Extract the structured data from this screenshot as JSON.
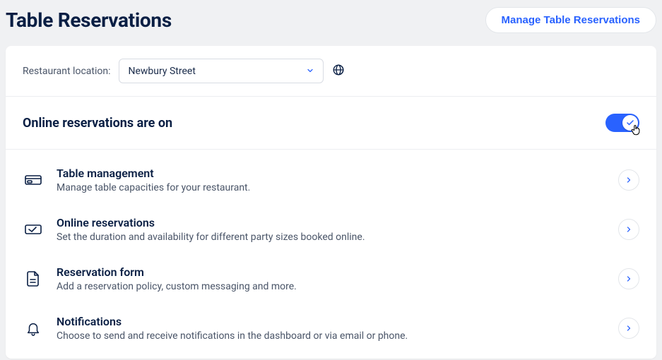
{
  "header": {
    "title": "Table Reservations",
    "manage_button": "Manage Table Reservations"
  },
  "location": {
    "label": "Restaurant location:",
    "selected": "Newbury Street"
  },
  "toggle": {
    "label": "Online reservations are on",
    "state": "on"
  },
  "sections": [
    {
      "icon": "table-icon",
      "title": "Table management",
      "desc": "Manage table capacities for your restaurant."
    },
    {
      "icon": "calendar-check-icon",
      "title": "Online reservations",
      "desc": "Set the duration and availability for different party sizes booked online."
    },
    {
      "icon": "form-icon",
      "title": "Reservation form",
      "desc": "Add a reservation policy, custom messaging and more."
    },
    {
      "icon": "bell-icon",
      "title": "Notifications",
      "desc": "Choose to send and receive notifications in the dashboard or via email or phone."
    }
  ]
}
